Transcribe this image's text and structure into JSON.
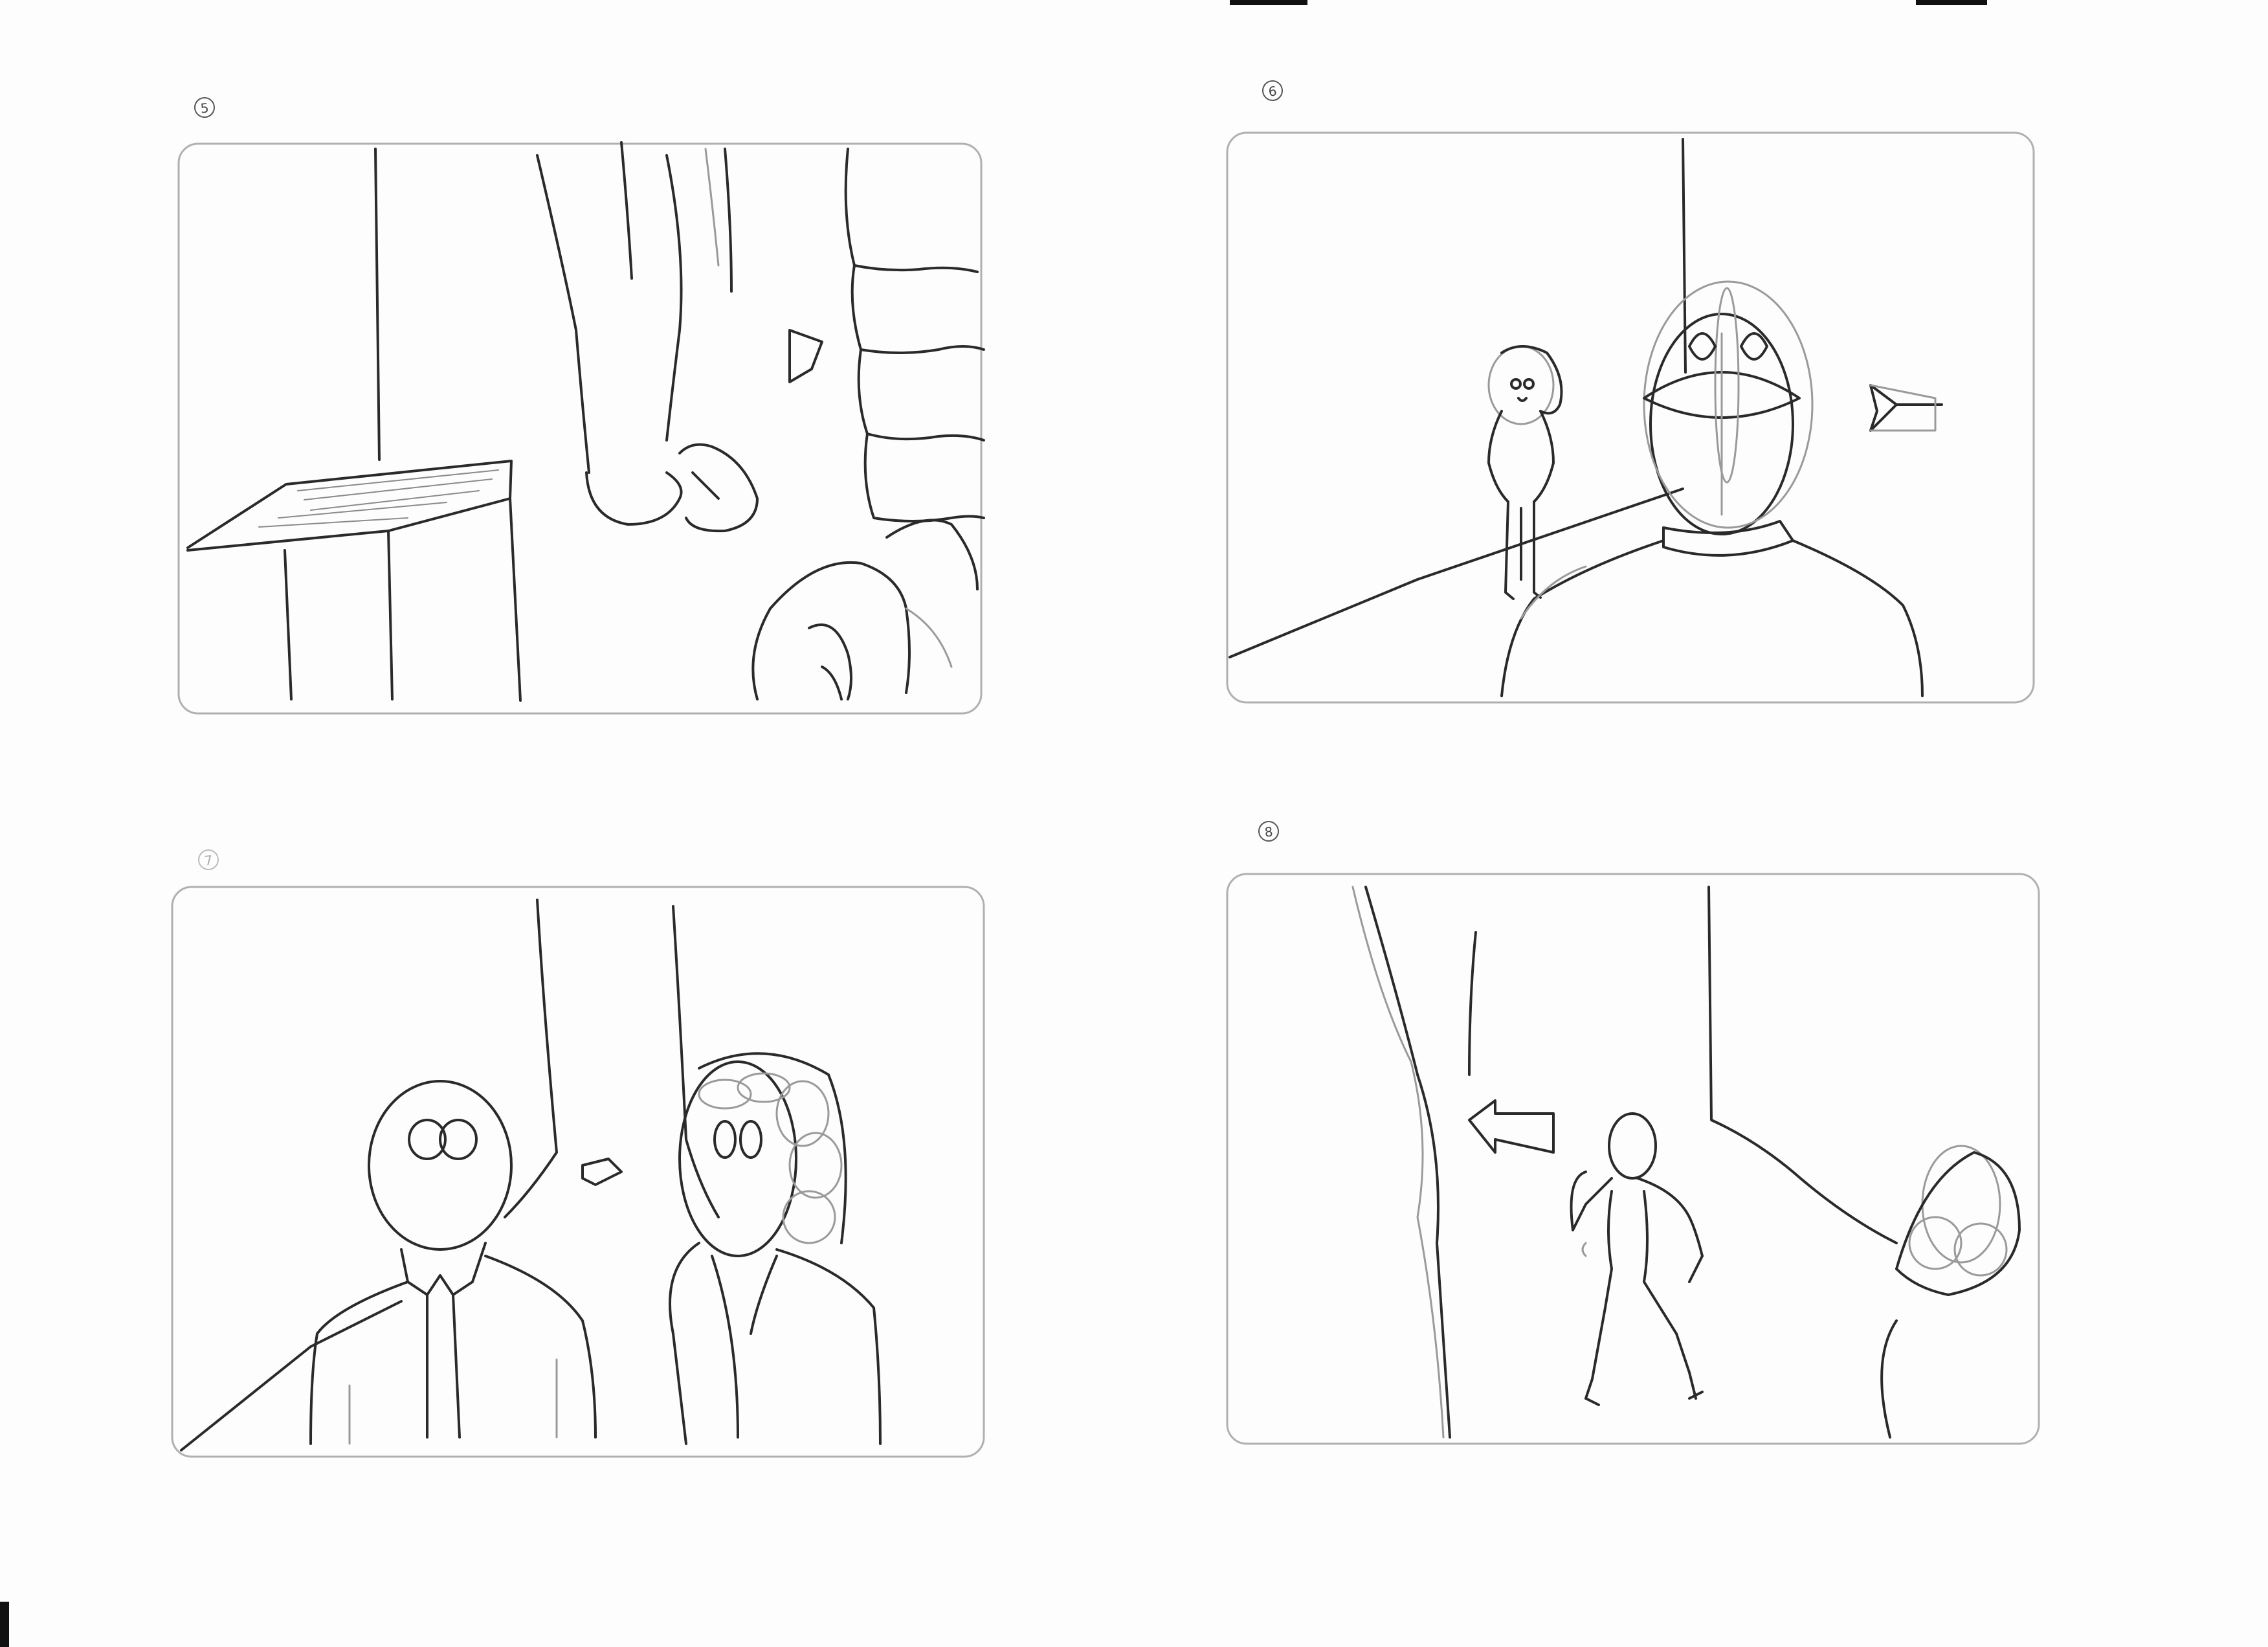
{
  "sheet": {
    "title": "",
    "panels": [
      {
        "id": "panel-5",
        "number": "5",
        "shot": "hand-on-box"
      },
      {
        "id": "panel-6",
        "number": "6",
        "shot": "over-shoulder-figure"
      },
      {
        "id": "panel-7",
        "number": "7",
        "shot": "two-shot"
      },
      {
        "id": "panel-8",
        "number": "8",
        "shot": "walking-figure"
      }
    ]
  },
  "colors": {
    "pencil": "#2a2a2a",
    "light_pencil": "#9a9a9a",
    "paper": "#fdfdfd"
  }
}
